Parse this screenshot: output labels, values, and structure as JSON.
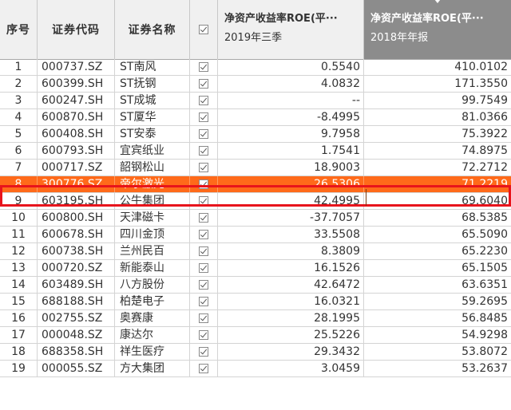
{
  "header": {
    "col_index": "序号",
    "col_code": "证券代码",
    "col_name": "证券名称",
    "col_roe_2019": {
      "title": "净资产收益率ROE(平···",
      "sub": "2019年三季"
    },
    "col_roe_2018": {
      "title": "净资产收益率ROE(平···",
      "sub": "2018年年报"
    }
  },
  "colors": {
    "selected_row": "#ff6a1a",
    "highlight_border": "#e8141c",
    "sorted_header": "#8c8c8c"
  },
  "rows": [
    {
      "idx": "1",
      "code": "000737.SZ",
      "name": "ST南风",
      "roe2019": "0.5540",
      "roe2018": "410.0102"
    },
    {
      "idx": "2",
      "code": "600399.SH",
      "name": "ST抚钢",
      "roe2019": "4.0832",
      "roe2018": "171.3550"
    },
    {
      "idx": "3",
      "code": "600247.SH",
      "name": "ST成城",
      "roe2019": "--",
      "roe2018": "99.7549"
    },
    {
      "idx": "4",
      "code": "600870.SH",
      "name": "ST厦华",
      "roe2019": "-8.4995",
      "roe2018": "81.0366"
    },
    {
      "idx": "5",
      "code": "600408.SH",
      "name": "ST安泰",
      "roe2019": "9.7958",
      "roe2018": "75.3922"
    },
    {
      "idx": "6",
      "code": "600793.SH",
      "name": "宜宾纸业",
      "roe2019": "1.7541",
      "roe2018": "74.8975"
    },
    {
      "idx": "7",
      "code": "000717.SZ",
      "name": "韶钢松山",
      "roe2019": "18.9003",
      "roe2018": "72.2712"
    },
    {
      "idx": "8",
      "code": "300776.SZ",
      "name": "帝尔激光",
      "roe2019": "26.5306",
      "roe2018": "71.2219"
    },
    {
      "idx": "9",
      "code": "603195.SH",
      "name": "公牛集团",
      "roe2019": "42.4995",
      "roe2018": "69.6040"
    },
    {
      "idx": "10",
      "code": "600800.SH",
      "name": "天津磁卡",
      "roe2019": "-37.7057",
      "roe2018": "68.5385"
    },
    {
      "idx": "11",
      "code": "600678.SH",
      "name": "四川金顶",
      "roe2019": "33.5508",
      "roe2018": "65.5090"
    },
    {
      "idx": "12",
      "code": "600738.SH",
      "name": "兰州民百",
      "roe2019": "8.3809",
      "roe2018": "65.2230"
    },
    {
      "idx": "13",
      "code": "000720.SZ",
      "name": "新能泰山",
      "roe2019": "16.1526",
      "roe2018": "65.1505"
    },
    {
      "idx": "14",
      "code": "603489.SH",
      "name": "八方股份",
      "roe2019": "42.6472",
      "roe2018": "63.6351"
    },
    {
      "idx": "15",
      "code": "688188.SH",
      "name": "柏楚电子",
      "roe2019": "16.0321",
      "roe2018": "59.2695"
    },
    {
      "idx": "16",
      "code": "002755.SZ",
      "name": "奥赛康",
      "roe2019": "28.1995",
      "roe2018": "56.8485"
    },
    {
      "idx": "17",
      "code": "000048.SZ",
      "name": "康达尔",
      "roe2019": "25.5226",
      "roe2018": "54.9298"
    },
    {
      "idx": "18",
      "code": "688358.SH",
      "name": "祥生医疗",
      "roe2019": "29.3432",
      "roe2018": "53.8072"
    },
    {
      "idx": "19",
      "code": "000055.SZ",
      "name": "方大集团",
      "roe2019": "3.0459",
      "roe2018": "53.2637"
    }
  ],
  "selected_row_index": 7
}
